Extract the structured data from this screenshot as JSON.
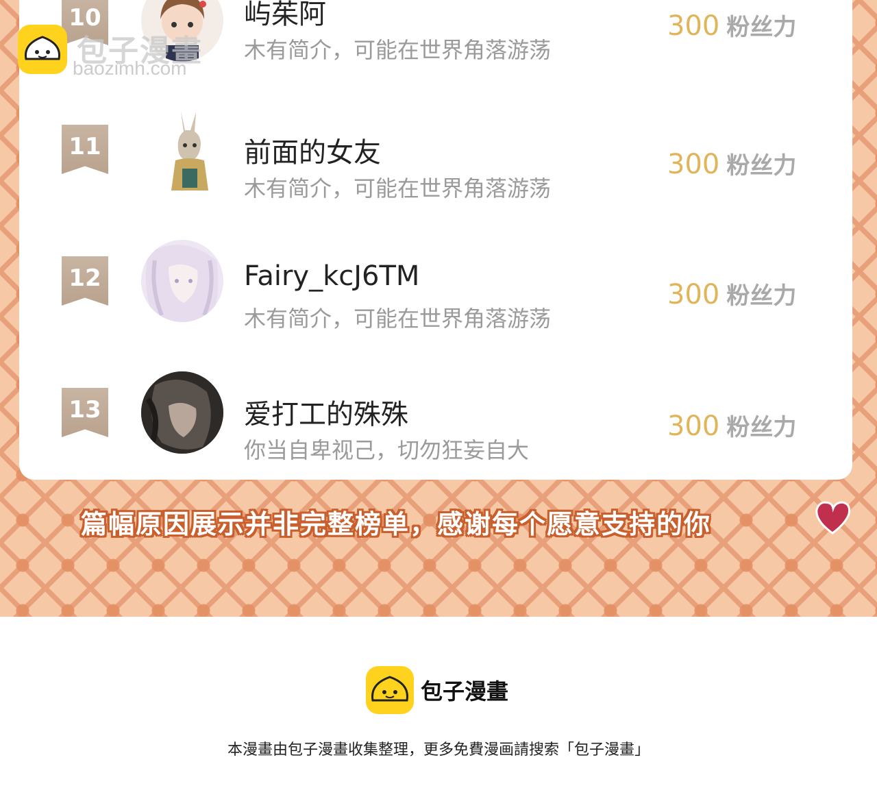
{
  "watermark": {
    "title": "包子漫畫",
    "url": "baozimh.com",
    "logo_icon": "bun-icon"
  },
  "ranking": [
    {
      "rank": "10",
      "name": "屿茱阿",
      "bio": "木有简介，可能在世界角落游荡",
      "score": "300",
      "unit": "粉丝力"
    },
    {
      "rank": "11",
      "name": "前面的女友",
      "bio": "木有简介，可能在世界角落游荡",
      "score": "300",
      "unit": "粉丝力"
    },
    {
      "rank": "12",
      "name": "Fairy_kcJ6TM",
      "bio": "木有简介，可能在世界角落游荡",
      "score": "300",
      "unit": "粉丝力"
    },
    {
      "rank": "13",
      "name": "爱打工的殊殊",
      "bio": "你当自卑视己，切勿狂妄自大",
      "score": "300",
      "unit": "粉丝力"
    }
  ],
  "banner": {
    "text": "篇幅原因展示并非完整榜单，感谢每个愿意支持的你",
    "icon": "heart-icon"
  },
  "footer": {
    "logo_icon": "bun-icon",
    "title": "包子漫畫",
    "note": "本漫畫由包子漫畫收集整理，更多免費漫画請搜索「包子漫畫」"
  },
  "colors": {
    "background": "#f6c8a6",
    "pattern": "#e8a07a",
    "score": "#e0b55a",
    "rank_badge": "#c8b4a2",
    "banner_outline": "#c85f2c",
    "logo": "#ffd21e"
  }
}
